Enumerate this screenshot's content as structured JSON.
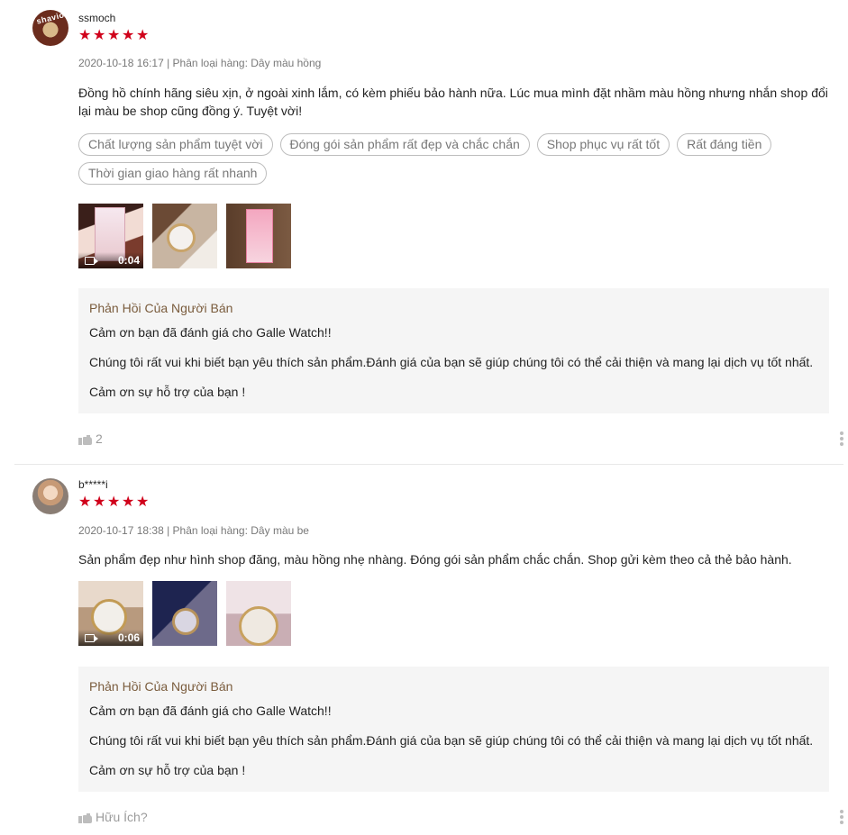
{
  "reviews": [
    {
      "author": "ssmoch",
      "avatar_text": "shavio",
      "rating": 5,
      "meta": "2020-10-18 16:17 | Phân loại hàng: Dây màu hồng",
      "content": "Đồng hồ chính hãng siêu xịn, ở ngoài xinh lắm, có kèm phiếu bảo hành nữa. Lúc mua mình đặt nhầm màu hồng nhưng nhắn shop đổi lại màu be shop cũng đồng ý. Tuyệt vời!",
      "tags": [
        "Chất lượng sản phẩm tuyệt vời",
        "Đóng gói sản phẩm rất đẹp và chắc chắn",
        "Shop phục vụ rất tốt",
        "Rất đáng tiền",
        "Thời gian giao hàng rất nhanh"
      ],
      "video_duration": "0:04",
      "seller_reply": {
        "title": "Phản Hồi Của Người Bán",
        "line1": "Cảm ơn bạn đã đánh giá cho Galle Watch!!",
        "line2": "Chúng tôi rất vui khi biết bạn yêu thích sản phẩm.Đánh giá của bạn sẽ giúp chúng tôi có thể cải thiện và mang lại dịch vụ tốt nhất.",
        "line3": "Cảm ơn sự hỗ trợ của bạn !"
      },
      "likes_label": "2"
    },
    {
      "author": "b*****i",
      "rating": 5,
      "meta": "2020-10-17 18:38 | Phân loại hàng: Dây màu be",
      "content": "Sản phẩm đẹp như hình shop đăng, màu hồng nhẹ nhàng. Đóng gói sản phẩm chắc chắn. Shop gửi kèm theo cả thẻ bảo hành.",
      "video_duration": "0:06",
      "seller_reply": {
        "title": "Phản Hồi Của Người Bán",
        "line1": "Cảm ơn bạn đã đánh giá cho Galle Watch!!",
        "line2": "Chúng tôi rất vui khi biết bạn yêu thích sản phẩm.Đánh giá của bạn sẽ giúp chúng tôi có thể cải thiện và mang lại dịch vụ tốt nhất.",
        "line3": "Cảm ơn sự hỗ trợ của bạn !"
      },
      "likes_label": "Hữu Ích?"
    }
  ],
  "colors": {
    "star": "#d0011b",
    "reply_title": "#7a5c3d",
    "reply_bg": "#f5f5f5"
  }
}
